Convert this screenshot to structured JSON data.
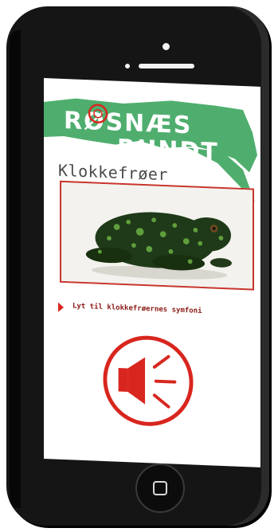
{
  "banner": {
    "line1": "RØSNÆS",
    "line2": "RUNDT",
    "color": "#4fae6e"
  },
  "page": {
    "title": "Klokkefrøer"
  },
  "photo": {
    "subject": "fire-bellied toad"
  },
  "action": {
    "label": "Lyt til klokkefrøernes symfoni"
  },
  "colors": {
    "accent": "#d8261e",
    "banner_green": "#4fae6e"
  },
  "icons": {
    "play": "play-arrow-icon",
    "sound": "speaker-icon",
    "home": "home-square-icon"
  }
}
